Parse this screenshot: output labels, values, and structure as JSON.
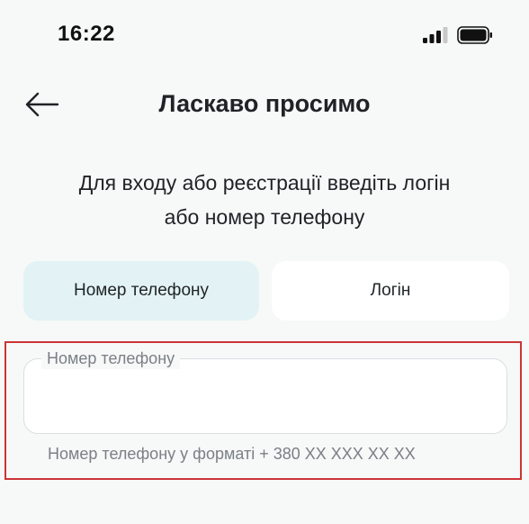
{
  "status_bar": {
    "time": "16:22"
  },
  "header": {
    "title": "Ласкаво просимо"
  },
  "subtitle": {
    "line1": "Для входу або реєстрації введіть логін",
    "line2": "або номер телефону"
  },
  "tabs": [
    {
      "label": "Номер телефону",
      "selected": true
    },
    {
      "label": "Логін",
      "selected": false
    }
  ],
  "phone_field": {
    "label": "Номер телефону",
    "value": "",
    "helper": "Номер телефону у форматі + 380 XX XXX XX XX"
  },
  "icons": {
    "back": "arrow-left-icon",
    "signal": "cellular-signal-icon",
    "battery": "battery-icon"
  },
  "colors": {
    "selected_tab_bg": "#e3f3f5",
    "highlight_border": "#cc3437",
    "helper_text": "#7a8085"
  }
}
